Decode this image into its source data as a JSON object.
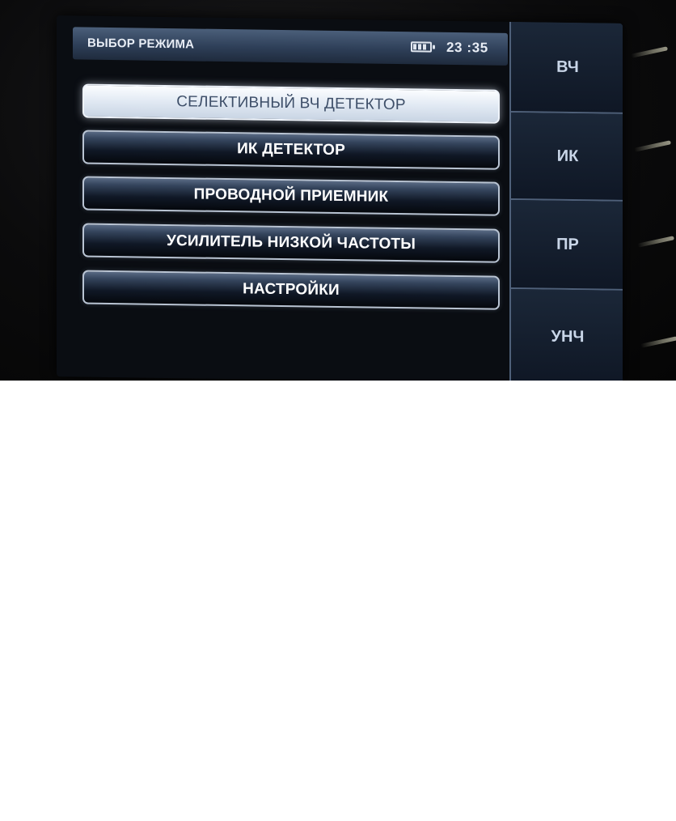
{
  "status_bar": {
    "title": "ВЫБОР РЕЖИМА",
    "battery_icon": "battery-icon",
    "battery_level": 0.75,
    "time": "23 :35"
  },
  "menu": {
    "items": [
      {
        "label": "СЕЛЕКТИВНЫЙ ВЧ ДЕТЕКТОР",
        "selected": true
      },
      {
        "label": "ИК ДЕТЕКТОР",
        "selected": false
      },
      {
        "label": "ПРОВОДНОЙ ПРИЕМНИК",
        "selected": false
      },
      {
        "label": "УСИЛИТЕЛЬ НИЗКОЙ ЧАСТОТЫ",
        "selected": false
      },
      {
        "label": "НАСТРОЙКИ",
        "selected": false
      }
    ]
  },
  "softkeys": {
    "items": [
      {
        "label": "ВЧ"
      },
      {
        "label": "ИК"
      },
      {
        "label": "ПР"
      },
      {
        "label": "УНЧ"
      }
    ]
  },
  "colors": {
    "selected_bg": "#e1e9f3",
    "selected_text": "#3d4e68",
    "button_border": "#b9c4d3",
    "status_bar": "#2e3f58"
  }
}
